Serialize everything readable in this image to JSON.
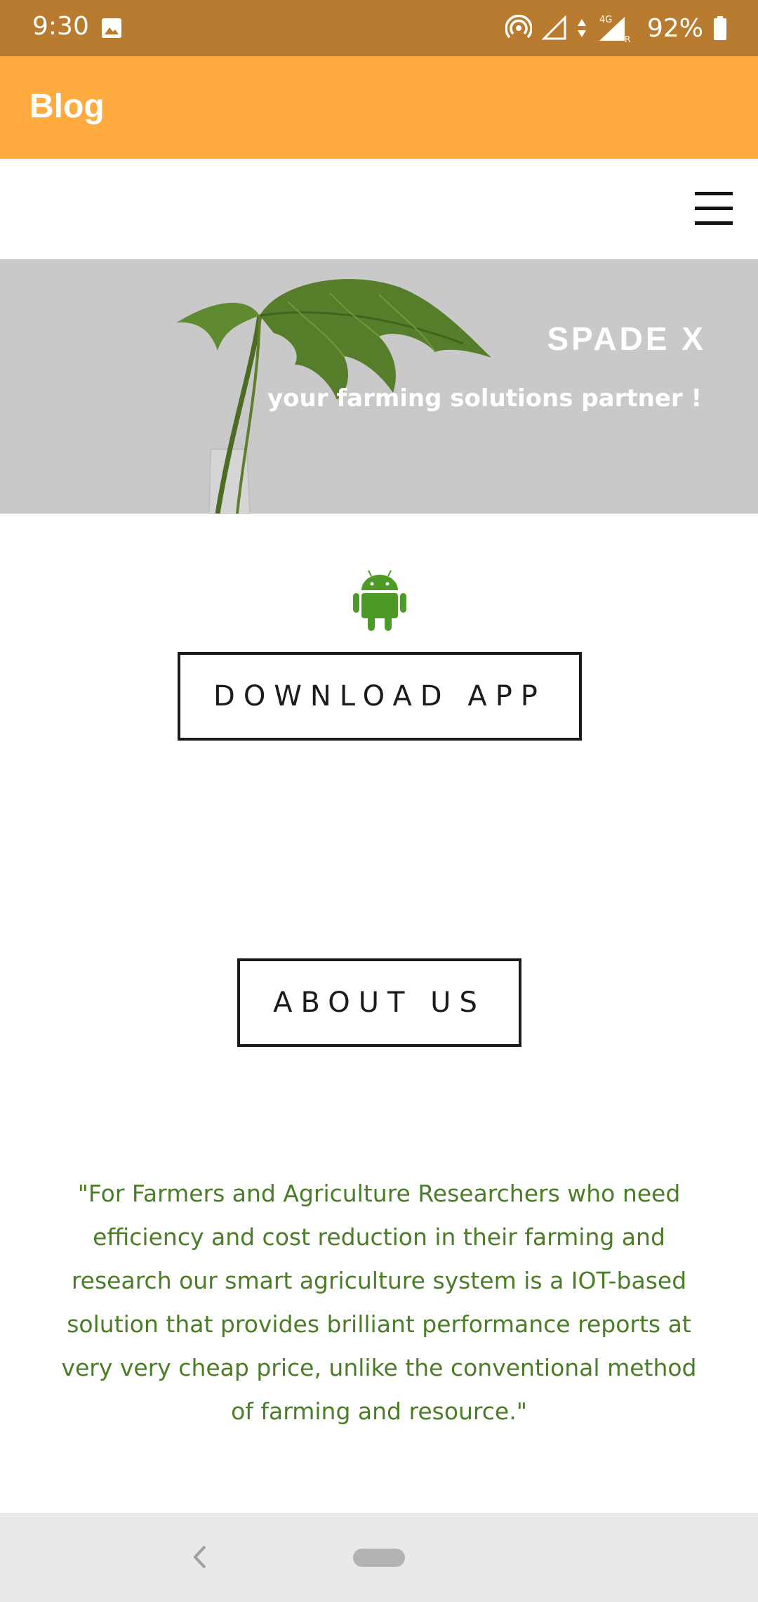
{
  "status_bar": {
    "time": "9:30",
    "network_label": "4G",
    "battery_percent": "92%",
    "icons": [
      "image-icon",
      "hotspot-icon",
      "signal-icon",
      "data-arrows-icon",
      "battery-icon"
    ]
  },
  "app_bar": {
    "title": "Blog",
    "color": "#ffab40"
  },
  "navigation": {
    "menu_icon": "hamburger-menu-icon"
  },
  "hero": {
    "title": "SPADE X",
    "subtitle": "your farming solutions partner !",
    "image": "monstera-leaf-in-vase"
  },
  "download": {
    "icon": "android-icon",
    "button_label": "DOWNLOAD APP"
  },
  "about": {
    "button_label": "ABOUT US"
  },
  "quote": {
    "text": "\"For Farmers and Agriculture Researchers who need efficiency and cost reduction in their farming and research our smart agriculture system is a IOT-based solution that provides brilliant performance reports at very very cheap price, unlike the conventional method of farming and resource.\"",
    "color": "#4a7d26"
  },
  "system_nav": {
    "back_icon": "back-chevron-icon",
    "home_icon": "home-pill-icon"
  }
}
